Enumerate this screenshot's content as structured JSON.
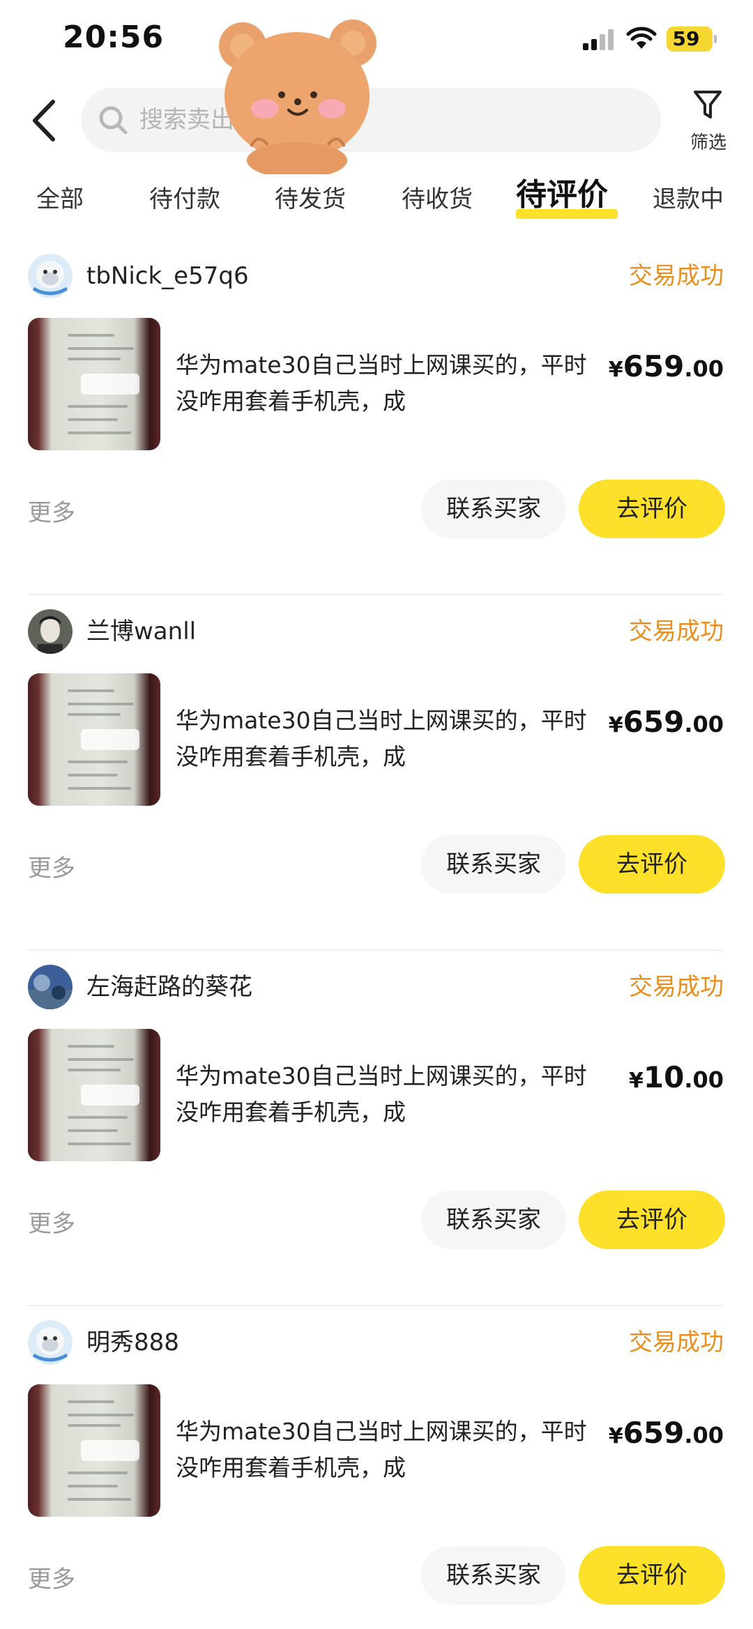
{
  "status_bar": {
    "time": "20:56",
    "battery": "59"
  },
  "header": {
    "search_placeholder": "搜索卖出",
    "filter_label": "筛选"
  },
  "tabs": [
    {
      "label": "全部"
    },
    {
      "label": "待付款"
    },
    {
      "label": "待发货"
    },
    {
      "label": "待收货"
    },
    {
      "label": "待评价",
      "active": true
    },
    {
      "label": "退款中"
    }
  ],
  "orders": [
    {
      "seller": "tbNick_e57q6",
      "status": "交易成功",
      "title": "华为mate30自己当时上网课买的，平时没咋用套着手机壳，成",
      "price_symbol": "¥",
      "price_int": "659",
      "price_dec": ".00",
      "more": "更多",
      "contact": "联系买家",
      "review": "去评价"
    },
    {
      "seller": "兰博wanll",
      "status": "交易成功",
      "title": "华为mate30自己当时上网课买的，平时没咋用套着手机壳，成",
      "price_symbol": "¥",
      "price_int": "659",
      "price_dec": ".00",
      "more": "更多",
      "contact": "联系买家",
      "review": "去评价"
    },
    {
      "seller": "左海赶路的葵花",
      "status": "交易成功",
      "title": "华为mate30自己当时上网课买的，平时没咋用套着手机壳，成",
      "price_symbol": "¥",
      "price_int": "10",
      "price_dec": ".00",
      "more": "更多",
      "contact": "联系买家",
      "review": "去评价"
    },
    {
      "seller": "明秀888",
      "status": "交易成功",
      "title": "华为mate30自己当时上网课买的，平时没咋用套着手机壳，成",
      "price_symbol": "¥",
      "price_int": "659",
      "price_dec": ".00",
      "more": "更多",
      "contact": "联系买家",
      "review": "去评价"
    }
  ],
  "colors": {
    "accent_yellow": "#fde02a",
    "status_orange": "#e88f1f",
    "muted_gray": "#9a9a9a"
  },
  "icons": {
    "back": "chevron-left-icon",
    "search": "search-icon",
    "filter": "funnel-icon"
  }
}
